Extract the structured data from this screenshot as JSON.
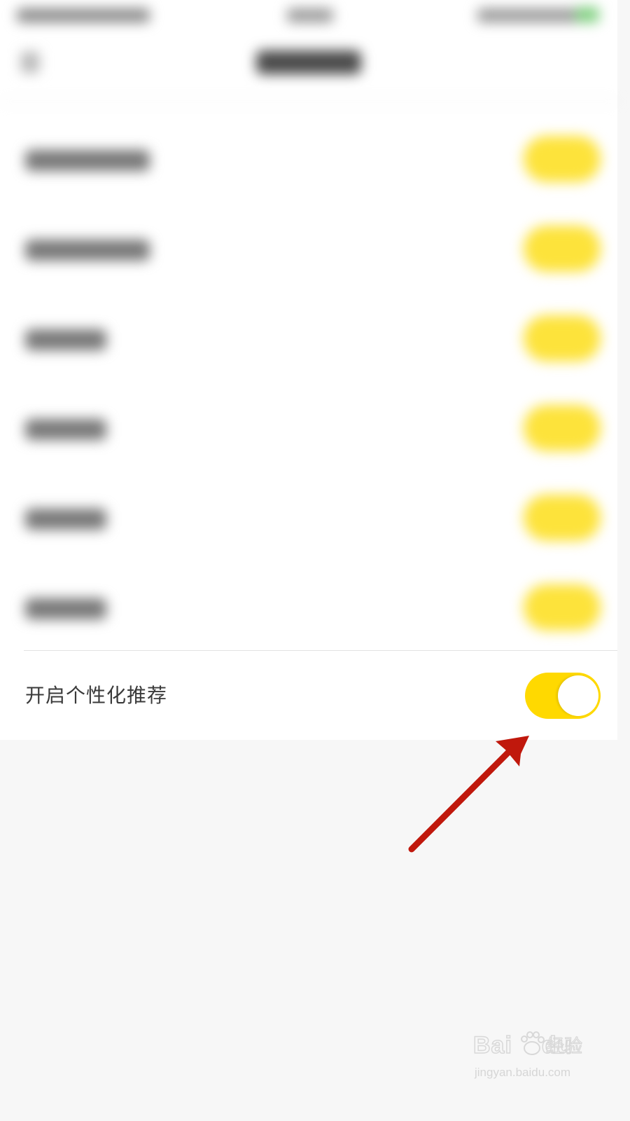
{
  "settings": {
    "personalized_recommendation": {
      "label": "开启个性化推荐",
      "enabled": true
    },
    "obscured_rows": [
      {
        "toggle_on": true
      },
      {
        "toggle_on": true
      },
      {
        "toggle_on": true
      },
      {
        "toggle_on": true
      },
      {
        "toggle_on": true
      },
      {
        "toggle_on": true
      }
    ]
  },
  "colors": {
    "toggle_on": "#ffd900",
    "toggle_knob": "#ffffff",
    "panel_bg": "#ffffff",
    "page_bg": "#f7f7f7",
    "arrow": "#c0180c",
    "label_text": "#3a3a3a"
  },
  "watermark": {
    "logo": "Baidu",
    "brand": "经验",
    "url": "jingyan.baidu.com"
  }
}
